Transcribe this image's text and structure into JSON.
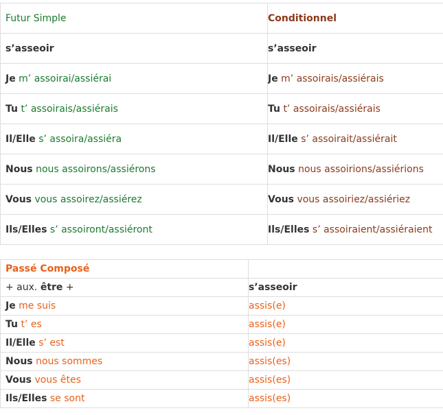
{
  "futur_conditionnel": {
    "header": {
      "futur": "Futur Simple",
      "conditionnel": "Conditionnel"
    },
    "verb_row": {
      "futur": "s’asseoir",
      "conditionnel": "s’asseoir"
    },
    "rows": [
      {
        "subject": "Je",
        "futur": "m’ assoirai/assiérai",
        "conditionnel": "m’ assoirais/assiérais"
      },
      {
        "subject": "Tu",
        "futur": "t’ assoirais/assiérais",
        "conditionnel": "t’ assoirais/assiérais"
      },
      {
        "subject": "Il/Elle",
        "futur": "s’ assoira/assiéra",
        "conditionnel": "s’ assoirait/assiérait"
      },
      {
        "subject": "Nous",
        "futur": "nous assoirons/assiérons",
        "conditionnel": "nous assoirions/assiérions"
      },
      {
        "subject": "Vous",
        "futur": "vous assoirez/assiérez",
        "conditionnel": "vous assoiriez/assiériez"
      },
      {
        "subject": "Ils/Elles",
        "futur": "s’ assoiront/assiéront",
        "conditionnel": "s’ assoiraient/assiéraient"
      }
    ]
  },
  "passe_compose": {
    "header": "Passé Composé",
    "aux_row": {
      "prefix": "+ aux.",
      "aux": "être",
      "suffix": "+",
      "verb": "s’asseoir"
    },
    "rows": [
      {
        "subject": "Je",
        "aux": "me suis",
        "participle": "assis(e)"
      },
      {
        "subject": "Tu",
        "aux": "t’ es",
        "participle": "assis(e)"
      },
      {
        "subject": "Il/Elle",
        "aux": "s’ est",
        "participle": "assis(e)"
      },
      {
        "subject": "Nous",
        "aux": "nous sommes",
        "participle": "assis(es)"
      },
      {
        "subject": "Vous",
        "aux": "vous êtes",
        "participle": "assis(es)"
      },
      {
        "subject": "Ils/Elles",
        "aux": "se sont",
        "participle": "assis(es)"
      }
    ]
  },
  "colors": {
    "futur": "#1a7a2e",
    "conditionnel": "#8b3a1a",
    "passe_compose": "#e8611a",
    "border": "#dddddd",
    "text": "#333333"
  }
}
